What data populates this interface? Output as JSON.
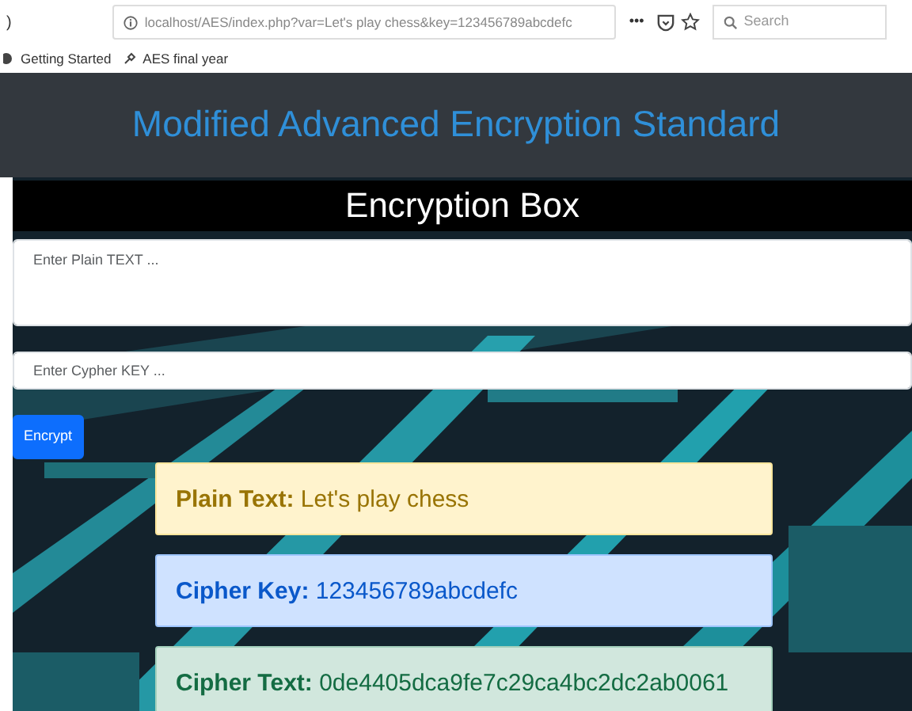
{
  "browser": {
    "back_glyph": ")",
    "url": "localhost/AES/index.php?var=Let's play chess&key=123456789abcdefc",
    "more_glyph": "•••",
    "search_placeholder": "Search",
    "bookmarks": [
      "Getting Started",
      "AES final year"
    ]
  },
  "header": {
    "title": "Modified Advanced Encryption Standard"
  },
  "box": {
    "title": "Encryption Box",
    "plain_field": {
      "placeholder": "Enter Plain TEXT ..."
    },
    "key_field": {
      "placeholder": "Enter Cypher KEY ..."
    },
    "button": "Encrypt"
  },
  "results": [
    {
      "kind": "warning",
      "text": "**Plain Text:** Let's play chess"
    },
    {
      "kind": "primary",
      "text": "**Cipher Key:** 123456789abcdefc"
    },
    {
      "kind": "success",
      "text": "**Cipher Text:** 0de4405dca9fe7c29ca4bc2dc2ab0061"
    }
  ]
}
